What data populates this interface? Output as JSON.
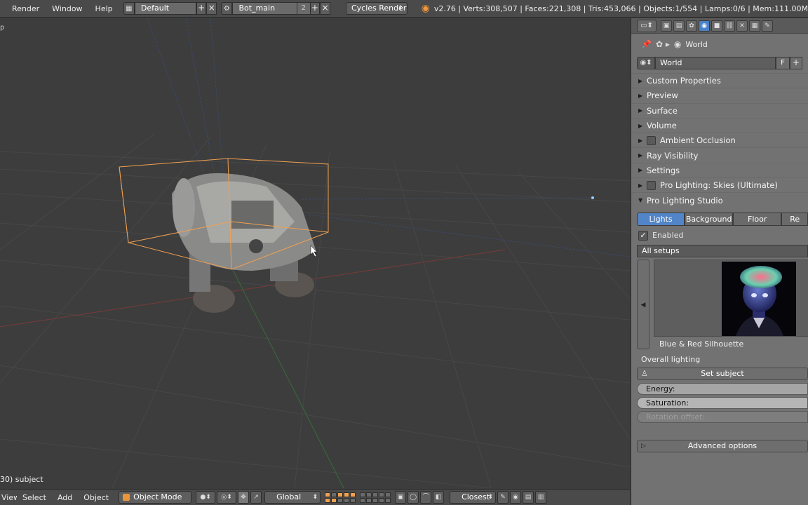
{
  "topbar": {
    "menus": [
      "Render",
      "Window",
      "Help"
    ],
    "screen_layout": "Default",
    "scene_name": "Bot_main",
    "scene_users": "2",
    "render_engine": "Cycles Render",
    "stats": "v2.76 | Verts:308,507 | Faces:221,308 | Tris:453,066 | Objects:1/554 | Lamps:0/6 | Mem:111.00M"
  },
  "viewport": {
    "status_text": "30) subject",
    "corner_text": "p"
  },
  "bottombar": {
    "menus": [
      "View",
      "Select",
      "Add",
      "Object"
    ],
    "mode": "Object Mode",
    "orientation": "Global",
    "snap_target": "Closest"
  },
  "panel": {
    "breadcrumb": "World",
    "world_name": "World",
    "world_flag": "F",
    "sections": [
      {
        "label": "Custom Properties",
        "check": false,
        "open": false
      },
      {
        "label": "Preview",
        "check": false,
        "open": false
      },
      {
        "label": "Surface",
        "check": false,
        "open": false
      },
      {
        "label": "Volume",
        "check": false,
        "open": false
      },
      {
        "label": "Ambient Occlusion",
        "check": true,
        "open": false
      },
      {
        "label": "Ray Visibility",
        "check": false,
        "open": false
      },
      {
        "label": "Settings",
        "check": false,
        "open": false
      },
      {
        "label": "Pro Lighting: Skies (Ultimate)",
        "check": true,
        "open": false
      },
      {
        "label": "Pro Lighting Studio",
        "check": false,
        "open": true
      }
    ],
    "tabs": [
      "Lights",
      "Background",
      "Floor",
      "Re"
    ],
    "active_tab": "Lights",
    "enabled_label": "Enabled",
    "setups_label": "All setups",
    "preview_caption": "Blue & Red Silhouette",
    "overall_lighting": "Overall lighting",
    "set_subject": "Set subject",
    "energy_label": "Energy:",
    "saturation_label": "Saturation:",
    "rotation_label": "Rotation offset:",
    "advanced_label": "Advanced options"
  },
  "colors": {
    "selection_outline": "#f0a050",
    "active_tab": "#5284c8",
    "viewport_bg": "#3d3d3d"
  }
}
